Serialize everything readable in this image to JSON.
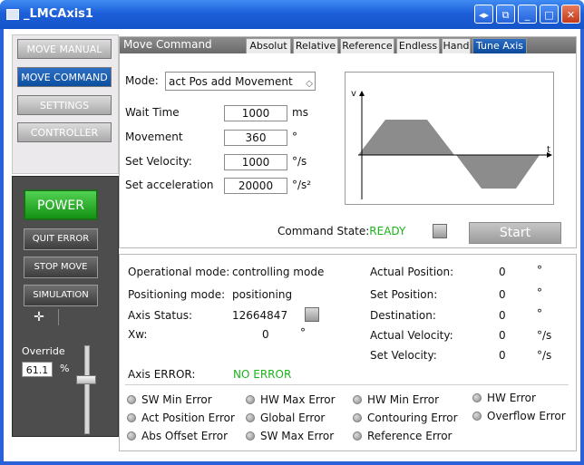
{
  "window": {
    "title": "_LMCAxis1",
    "title_buttons": [
      "◂▸",
      "⧉",
      "_",
      "□",
      "✕"
    ]
  },
  "nav": {
    "items": [
      {
        "label": "MOVE MANUAL",
        "active": false
      },
      {
        "label": "MOVE COMMAND",
        "active": true
      },
      {
        "label": "SETTINGS",
        "active": false
      },
      {
        "label": "CONTROLLER",
        "active": false
      }
    ]
  },
  "control": {
    "power": "POWER",
    "quit_error": "QUIT ERROR",
    "stop_move": "STOP MOVE",
    "simulation": "SIMULATION",
    "override_label": "Override",
    "override_value": "61.1",
    "override_unit": "%",
    "override_level": 0.611
  },
  "move_command": {
    "title": "Move Command",
    "tabs": [
      {
        "label": "Absolut",
        "active": false
      },
      {
        "label": "Relative",
        "active": false
      },
      {
        "label": "Reference",
        "active": false
      },
      {
        "label": "Endless",
        "active": false
      },
      {
        "label": "Hand",
        "active": false
      },
      {
        "label": "Tune Axis",
        "active": true
      }
    ],
    "mode_label": "Mode:",
    "mode_value": "act Pos add Movement",
    "wait_time": {
      "label": "Wait Time",
      "value": "1000",
      "unit": "ms"
    },
    "movement": {
      "label": "Movement",
      "value": "360",
      "unit": "°"
    },
    "set_velocity": {
      "label": "Set Velocity:",
      "value": "1000",
      "unit": "°/s"
    },
    "set_acceleration": {
      "label": "Set acceleration",
      "value": "20000",
      "unit": "°/s²"
    },
    "diagram": {
      "y_axis": "v",
      "x_axis": "t"
    },
    "command_state_label": "Command State:",
    "command_state_value": "READY",
    "start_button": "Start"
  },
  "status": {
    "operational_mode": {
      "label": "Operational mode:",
      "value": "controlling mode"
    },
    "positioning_mode": {
      "label": "Positioning mode:",
      "value": "positioning"
    },
    "axis_status": {
      "label": "Axis Status:",
      "value": "12664847"
    },
    "xw": {
      "label": "Xw:",
      "value": "0",
      "unit": "°"
    },
    "actual_position": {
      "label": "Actual Position:",
      "value": "0",
      "unit": "°"
    },
    "set_position": {
      "label": "Set Position:",
      "value": "0",
      "unit": "°"
    },
    "destination": {
      "label": "Destination:",
      "value": "0",
      "unit": "°"
    },
    "actual_velocity": {
      "label": "Actual Velocity:",
      "value": "0",
      "unit": "°/s"
    },
    "set_velocity": {
      "label": "Set Velocity:",
      "value": "0",
      "unit": "°/s"
    },
    "axis_error_label": "Axis ERROR:",
    "axis_error_value": "NO ERROR"
  },
  "errors": [
    "SW Min Error",
    "Act Position Error",
    "Abs Offset Error",
    "HW Max Error",
    "Global Error",
    "SW Max Error",
    "HW Min Error",
    "Contouring Error",
    "Reference Error",
    "HW Error",
    "Overflow Error"
  ],
  "colors": {
    "accent": "#0c4e9e",
    "ok": "#1bb31b",
    "power": "#129112"
  }
}
